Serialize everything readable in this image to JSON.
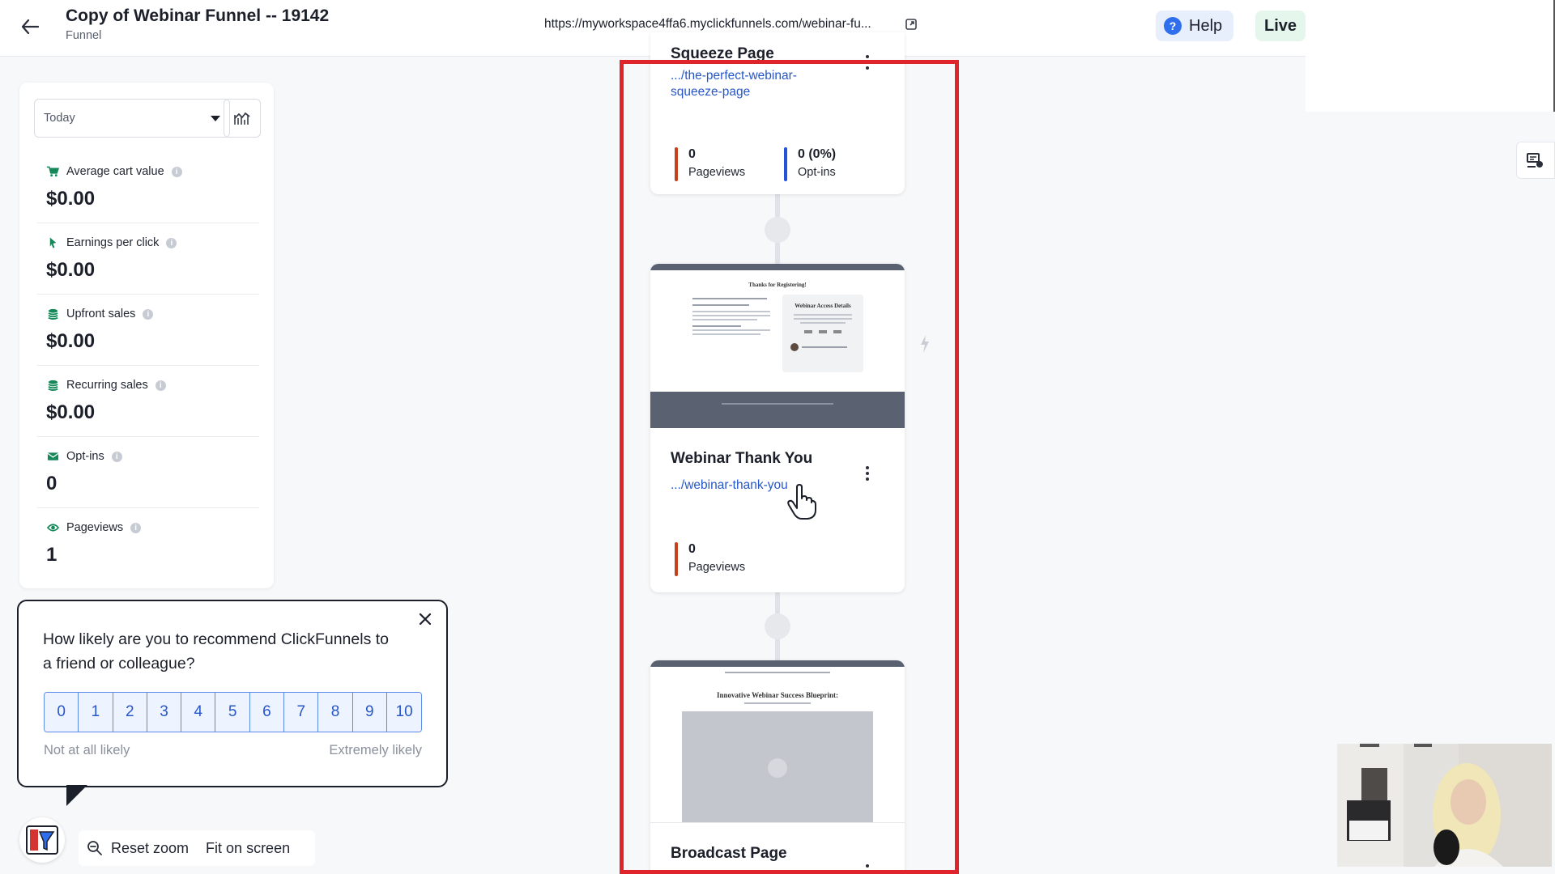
{
  "header": {
    "title": "Copy of Webinar Funnel -- 19142",
    "subtitle": "Funnel",
    "url": "https://myworkspace4ffa6.myclickfunnels.com/webinar-fu...",
    "help_label": "Help",
    "help_icon": "?",
    "live_label": "Live"
  },
  "stats_panel": {
    "date_range": "Today",
    "metrics": [
      {
        "label": "Average cart value",
        "value": "$0.00",
        "icon": "cart-icon"
      },
      {
        "label": "Earnings per click",
        "value": "$0.00",
        "icon": "cursor-icon"
      },
      {
        "label": "Upfront sales",
        "value": "$0.00",
        "icon": "coins-icon"
      },
      {
        "label": "Recurring sales",
        "value": "$0.00",
        "icon": "coins-icon"
      },
      {
        "label": "Opt-ins",
        "value": "0",
        "icon": "mail-icon"
      },
      {
        "label": "Pageviews",
        "value": "1",
        "icon": "eye-icon"
      }
    ]
  },
  "funnel_steps": [
    {
      "title": "Squeeze Page",
      "link": ".../the-perfect-webinar-squeeze-page",
      "link_line1": ".../the-perfect-webinar-",
      "link_line2": "squeeze-page",
      "metrics": [
        {
          "value": "0",
          "label": "Pageviews",
          "color": "#c4421b"
        },
        {
          "value": "0 (0%)",
          "label": "Opt-ins",
          "color": "#2154d6"
        }
      ]
    },
    {
      "title": "Webinar Thank You",
      "link": ".../webinar-thank-you",
      "thumb_heading": "Thanks for Registering!",
      "thumb_box_title": "Webinar Access Details",
      "metrics": [
        {
          "value": "0",
          "label": "Pageviews",
          "color": "#c4421b"
        }
      ]
    },
    {
      "title": "Broadcast Page",
      "thumb_heading": "Innovative Webinar Success Blueprint:"
    }
  ],
  "survey": {
    "question": "How likely are you to recommend ClickFunnels to a friend or colleague?",
    "scale": [
      "0",
      "1",
      "2",
      "3",
      "4",
      "5",
      "6",
      "7",
      "8",
      "9",
      "10"
    ],
    "low_label": "Not at all likely",
    "high_label": "Extremely likely"
  },
  "zoom_controls": {
    "reset_label": "Reset zoom",
    "fit_label": "Fit on screen"
  },
  "colors": {
    "frame_highlight": "#e0242c",
    "link": "#2656c7",
    "live_bg": "#e5f7ec",
    "help_bg": "#e8effc",
    "icon_green": "#15885a"
  }
}
